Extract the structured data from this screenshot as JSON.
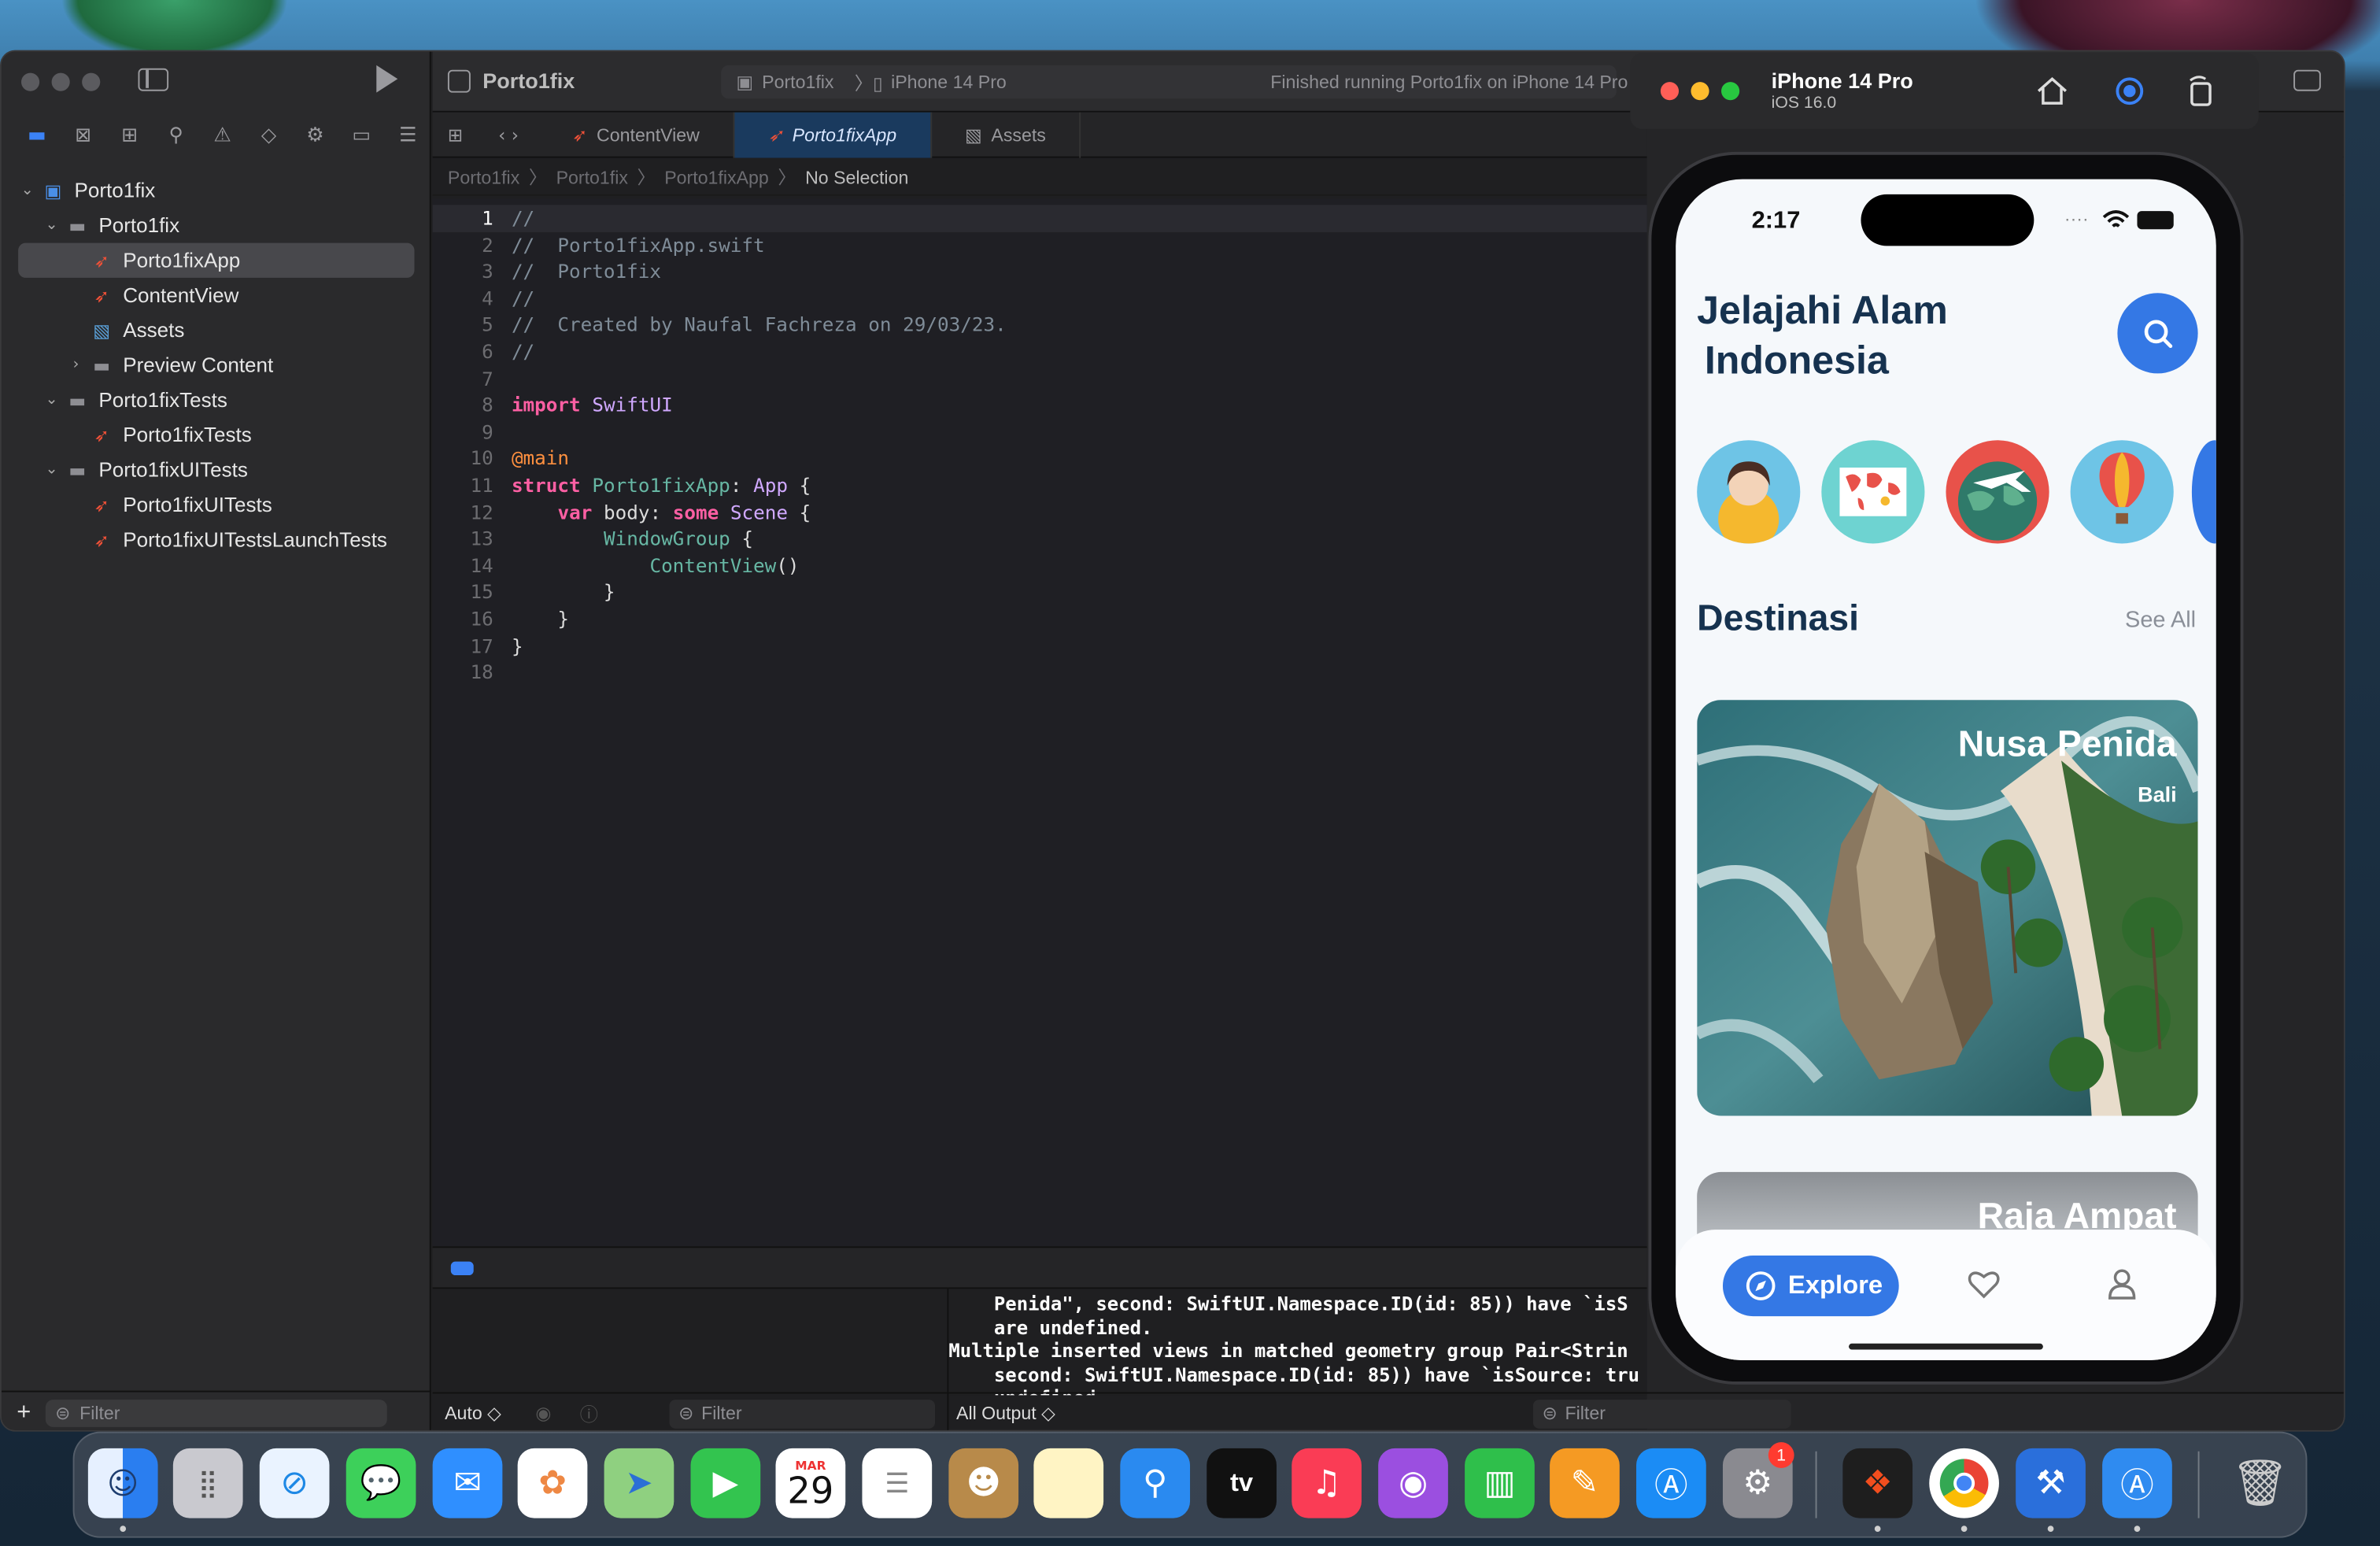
{
  "xcode": {
    "project_name": "Porto1fix",
    "scheme": "Porto1fix",
    "device": "iPhone 14 Pro",
    "status": "Finished running Porto1fix on iPhone 14 Pro",
    "tabs": [
      "ContentView",
      "Porto1fixApp",
      "Assets"
    ],
    "breadcrumb": [
      "Porto1fix",
      "Porto1fix",
      "Porto1fixApp",
      "No Selection"
    ],
    "navigator": [
      {
        "label": "Porto1fix"
      },
      {
        "label": "Porto1fix"
      },
      {
        "label": "Porto1fixApp"
      },
      {
        "label": "ContentView"
      },
      {
        "label": "Assets"
      },
      {
        "label": "Preview Content"
      },
      {
        "label": "Porto1fixTests"
      },
      {
        "label": "Porto1fixTests"
      },
      {
        "label": "Porto1fixUITests"
      },
      {
        "label": "Porto1fixUITests"
      },
      {
        "label": "Porto1fixUITestsLaunchTests"
      }
    ],
    "filter_placeholder": "Filter",
    "code_lines": [
      "//",
      "//  Porto1fixApp.swift",
      "//  Porto1fix",
      "//",
      "//  Created by Naufal Fachreza on 29/03/23.",
      "//",
      "",
      "import SwiftUI",
      "",
      "@main",
      "struct Porto1fixApp: App {",
      "    var body: some Scene {",
      "        WindowGroup {",
      "            ContentView()",
      "        }",
      "    }",
      "}",
      ""
    ],
    "console_lines": [
      "    Penida\", second: SwiftUI.Namespace.ID(id: 85)) have `isS",
      "    are undefined.",
      "Multiple inserted views in matched geometry group Pair<Strin",
      "    second: SwiftUI.Namespace.ID(id: 85)) have `isSource: tru",
      "    undefined."
    ],
    "auto_label": "Auto ◇",
    "all_output_label": "All Output ◇"
  },
  "simulator": {
    "device_name": "iPhone 14 Pro",
    "os_version": "iOS 16.0"
  },
  "app": {
    "time": "2:17",
    "title_line1": "Jelajahi Alam",
    "title_line2": "Indonesia",
    "section_title": "Destinasi",
    "see_all": "See All",
    "card_title": "Nusa Penida",
    "card_subtitle": "Bali",
    "card2_title": "Raja Ampat",
    "tab_explore": "Explore"
  },
  "dock": {
    "calendar_month": "MAR",
    "calendar_day": "29",
    "settings_badge": "1",
    "tv_label": "tv"
  },
  "colors": {
    "accent": "#3478e5",
    "title_navy": "#16324f"
  }
}
